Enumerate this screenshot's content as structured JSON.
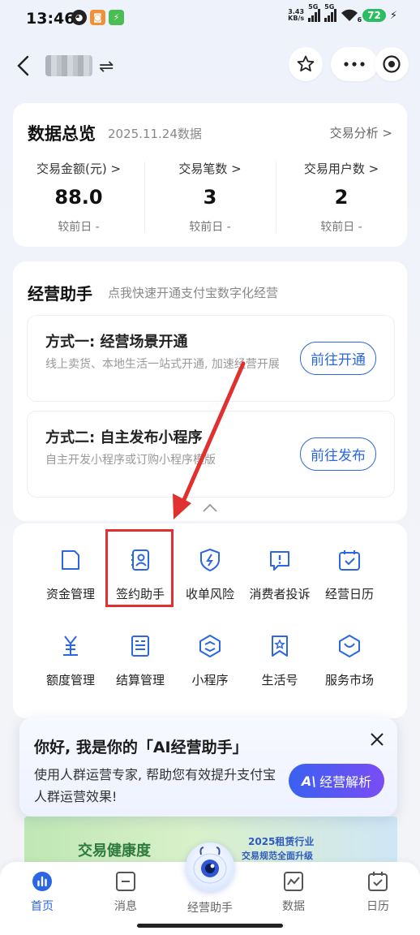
{
  "status_bar": {
    "time": "13:46",
    "net_speed_top": "3.43",
    "net_speed_bottom": "KB/s",
    "sim1": "5G",
    "sim2": "5G",
    "wifi_sub": "6",
    "battery": "72"
  },
  "header": {
    "switch_glyph": "⇌"
  },
  "overview": {
    "title": "数据总览",
    "date": "2025.11.24数据",
    "link": "交易分析 >",
    "metrics": [
      {
        "label": "交易金额(元) >",
        "value": "88.0",
        "compare": "较前日 -"
      },
      {
        "label": "交易笔数 >",
        "value": "3",
        "compare": "较前日 -"
      },
      {
        "label": "交易用户数 >",
        "value": "2",
        "compare": "较前日 -"
      }
    ]
  },
  "assistant": {
    "title": "经营助手",
    "subtitle": "点我快速开通支付宝数字化经营",
    "methods": [
      {
        "title": "方式一: 经营场景开通",
        "desc": "线上卖货、本地生活一站式开通, 加速经营开展",
        "button": "前往开通"
      },
      {
        "title": "方式二: 自主发布小程序",
        "desc": "自主开发小程序或订购小程序模版",
        "button": "前往发布"
      }
    ]
  },
  "grid": {
    "items": [
      {
        "label": "资金管理",
        "icon": "wallet-icon"
      },
      {
        "label": "签约助手",
        "icon": "contract-person-icon"
      },
      {
        "label": "收单风险",
        "icon": "shield-bolt-icon"
      },
      {
        "label": "消费者投诉",
        "icon": "complaint-icon"
      },
      {
        "label": "经营日历",
        "icon": "calendar-check-icon"
      },
      {
        "label": "额度管理",
        "icon": "yen-stack-icon"
      },
      {
        "label": "结算管理",
        "icon": "settlement-doc-icon"
      },
      {
        "label": "小程序",
        "icon": "mini-program-icon"
      },
      {
        "label": "生活号",
        "icon": "bookmark-star-icon"
      },
      {
        "label": "服务市场",
        "icon": "hexagon-service-icon"
      }
    ]
  },
  "popup": {
    "title": "你好, 我是你的「AI经营助手」",
    "body": "使用人群运营专家, 帮助您有效提升支付宝人群运营效果!",
    "button_ai": "A\\",
    "button_label": "经营解析"
  },
  "banner": {
    "left_text": "交易健康度",
    "right_line1": "2025租赁行业",
    "right_line2": "交易规范全面升级"
  },
  "tabbar": {
    "tabs": [
      {
        "label": "首页",
        "icon": "home-chart-icon"
      },
      {
        "label": "消息",
        "icon": "message-icon"
      },
      {
        "label": "经营助手",
        "icon": "assistant-robot-icon"
      },
      {
        "label": "数据",
        "icon": "data-chart-icon"
      },
      {
        "label": "日历",
        "icon": "calendar-icon"
      }
    ]
  },
  "colors": {
    "accent": "#2a67e0",
    "annotation": "#e03030",
    "battery": "#2bbd61"
  }
}
